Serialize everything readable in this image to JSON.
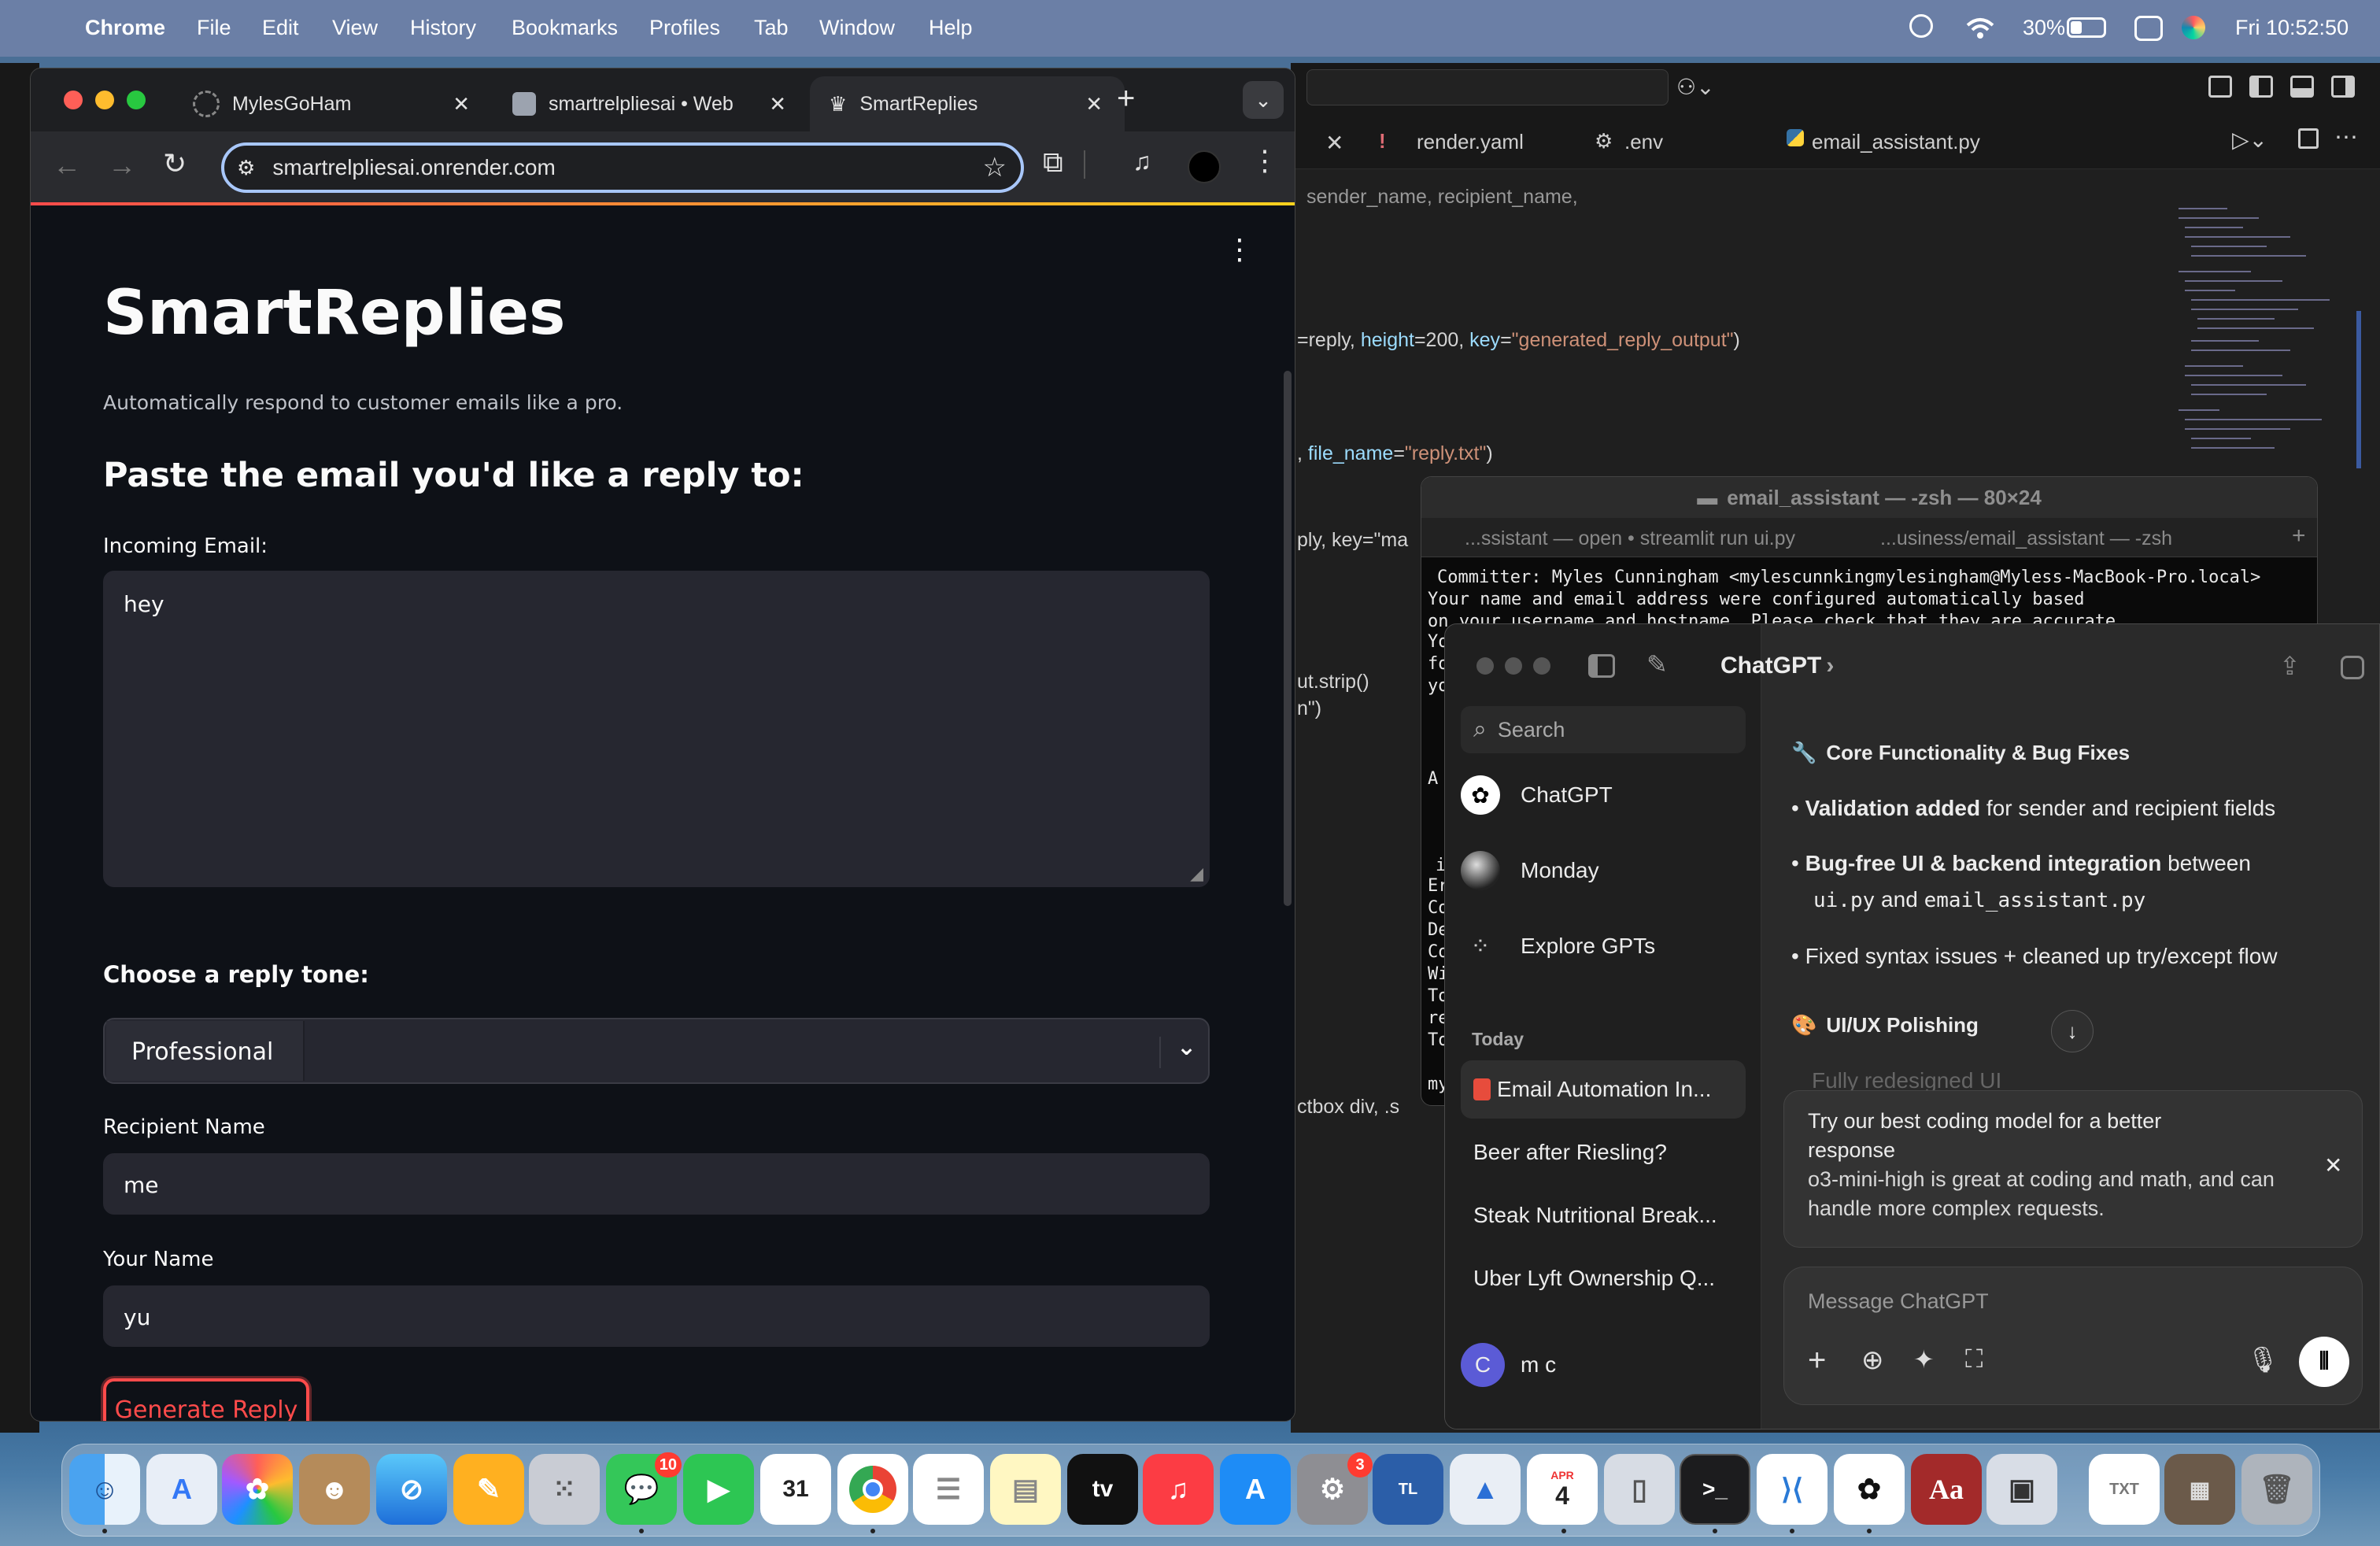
{
  "menubar": {
    "app": "Chrome",
    "items": [
      "File",
      "Edit",
      "View",
      "History",
      "Bookmarks",
      "Profiles",
      "Tab",
      "Window",
      "Help"
    ],
    "battery": "30%",
    "clock": "Fri 10:52:50"
  },
  "vscode": {
    "tabs": [
      {
        "icon": "!",
        "label": "render.yaml"
      },
      {
        "icon": "⚙",
        "label": ".env"
      },
      {
        "icon": "py",
        "label": "email_assistant.py"
      }
    ],
    "code": {
      "line1": "sender_name, recipient_name,",
      "line2_a": "=reply, ",
      "line2_b": "height",
      "line2_c": "=200, ",
      "line2_d": "key",
      "line2_e": "=",
      "line2_f": "\"generated_reply_output\"",
      "line2_g": ")",
      "line3_a": ", ",
      "line3_b": "file_name",
      "line3_c": "=",
      "line3_d": "\"reply.txt\"",
      "line3_e": ")",
      "line4": "ply, key=\"ma",
      "line5": "ut.strip()",
      "line6": "n\")",
      "line7": "ctbox div, .s"
    }
  },
  "terminal": {
    "title": "email_assistant — -zsh — 80×24",
    "tab1": "...ssistant — open • streamlit run ui.py",
    "tab2": "...usiness/email_assistant — -zsh",
    "lines": [
      "Committer: Myles Cunningham <mylescunnkingmylesingham@Myless-MacBook-Pro.local>",
      "Your name and email address were configured automatically based",
      "on your username and hostname. Please check that they are accurate."
    ],
    "side": [
      "Yo",
      "fo",
      "yo",
      "",
      "A",
      "",
      "",
      "i",
      "Er",
      "Co",
      "De",
      "Co",
      "Wi",
      "To",
      "re",
      "To",
      "",
      "my"
    ]
  },
  "chrome": {
    "tabs": [
      {
        "label": "MylesGoHam"
      },
      {
        "label": "smartrelpliesai • Web"
      },
      {
        "label": "SmartReplies"
      }
    ],
    "url": "smartrelpliesai.onrender.com",
    "page": {
      "title": "SmartReplies",
      "subtitle": "Automatically respond to customer emails like a pro.",
      "heading": "Paste the email you'd like a reply to:",
      "incoming_label": "Incoming Email:",
      "incoming_value": "hey",
      "tone_label": "Choose a reply tone:",
      "tone_value": "Professional",
      "recipient_label": "Recipient Name",
      "recipient_value": "me",
      "your_name_label": "Your Name",
      "your_name_value": "yu",
      "generate_label": "Generate Reply"
    }
  },
  "chatgpt": {
    "title": "ChatGPT",
    "search": "Search",
    "nav": [
      {
        "label": "ChatGPT"
      },
      {
        "label": "Monday"
      },
      {
        "label": "Explore GPTs"
      }
    ],
    "today": "Today",
    "history": [
      "Email Automation In...",
      "Beer after Riesling?",
      "Steak Nutritional Break...",
      "Uber Lyft Ownership Q..."
    ],
    "user_initial": "C",
    "user_name": "m c",
    "content": {
      "section1": "Core Functionality & Bug Fixes",
      "b1_bold": "Validation added",
      "b1_rest": " for sender and recipient fields",
      "b2_bold": "Bug-free UI & backend integration",
      "b2_rest": " between",
      "b2_code1": "ui.py",
      "b2_and": " and ",
      "b2_code2": "email_assistant.py",
      "b3": "Fixed syntax issues + cleaned up try/except flow",
      "section2": "UI/UX Polishing",
      "faded": "Fully redesigned UI"
    },
    "popup": {
      "title": "Try our best coding model for a better response",
      "body": "o3-mini-high is great at coding and math, and can handle more complex requests."
    },
    "input_placeholder": "Message ChatGPT"
  },
  "dock": {
    "messages_badge": "10",
    "settings_badge": "3",
    "calendar_day": "31",
    "reminder_month": "APR",
    "reminder_day": "4"
  },
  "colors": {
    "streamlit_bg": "#0e1117",
    "streamlit_field": "#262730",
    "accent_red": "#ff4b4b",
    "chatgpt_bg": "#2a2a2a"
  }
}
